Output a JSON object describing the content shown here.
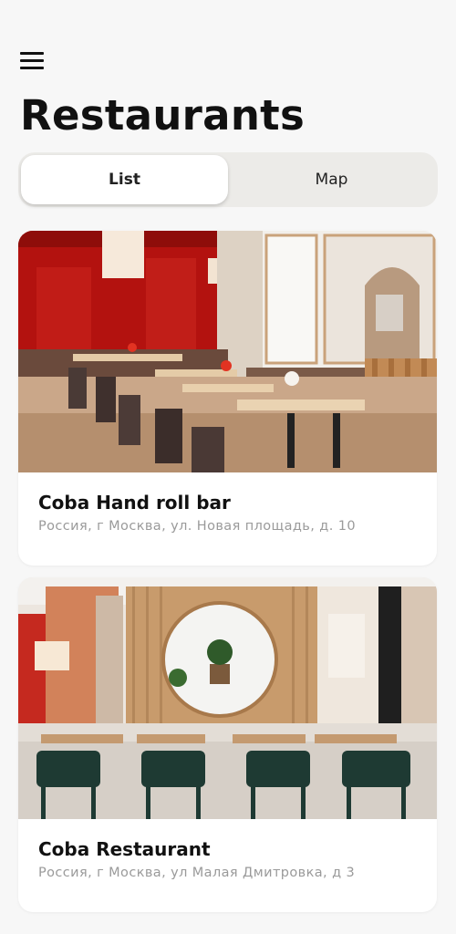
{
  "header": {
    "menu_icon": "hamburger-menu-icon",
    "title": "Restaurants"
  },
  "view_toggle": {
    "options": [
      {
        "label": "List",
        "selected": true
      },
      {
        "label": "Map",
        "selected": false
      }
    ]
  },
  "restaurants": [
    {
      "name": "Coba Hand roll bar",
      "address": "Россия, г Москва, ул. Новая площадь, д. 10",
      "photo": "restaurant-interior-red-wall-photo"
    },
    {
      "name": "Coba Restaurant",
      "address": "Россия, г Москва, ул Малая Дмитровка, д 3",
      "photo": "restaurant-interior-round-window-photo"
    }
  ]
}
